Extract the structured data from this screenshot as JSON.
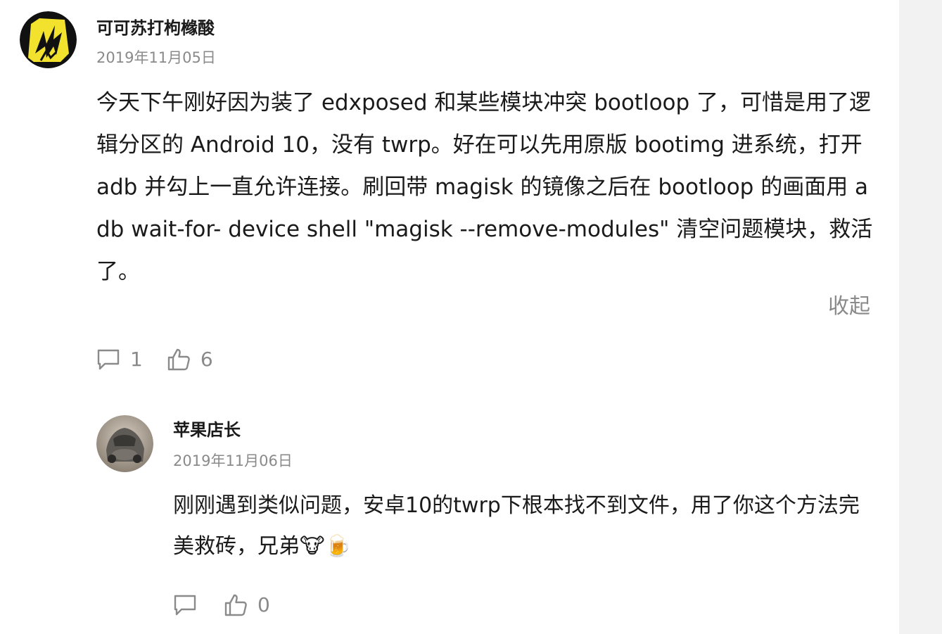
{
  "comment": {
    "author": "可可苏打枸橼酸",
    "date": "2019年11月05日",
    "content": "今天下午刚好因为装了 edxposed 和某些模块冲突 bootloop 了，可惜是用了逻辑分区的 Android 10，没有 twrp。好在可以先用原版 bootimg 进系统，打开 adb 并勾上一直允许连接。刷回带 magisk 的镜像之后在 bootloop 的画面用 adb wait-for- device shell \"magisk --remove-modules\" 清空问题模块，救活了。",
    "collapse_label": "收起",
    "reply_count": "1",
    "like_count": "6"
  },
  "reply": {
    "author": "苹果店长",
    "date": "2019年11月06日",
    "content": "刚刚遇到类似问题，安卓10的twrp下根本找不到文件，用了你这个方法完美救砖，兄弟🐮🍺",
    "like_count": "0"
  },
  "colors": {
    "text": "#1a1a1a",
    "muted": "#8a8a8a",
    "side_panel": "#f2f2f2"
  }
}
